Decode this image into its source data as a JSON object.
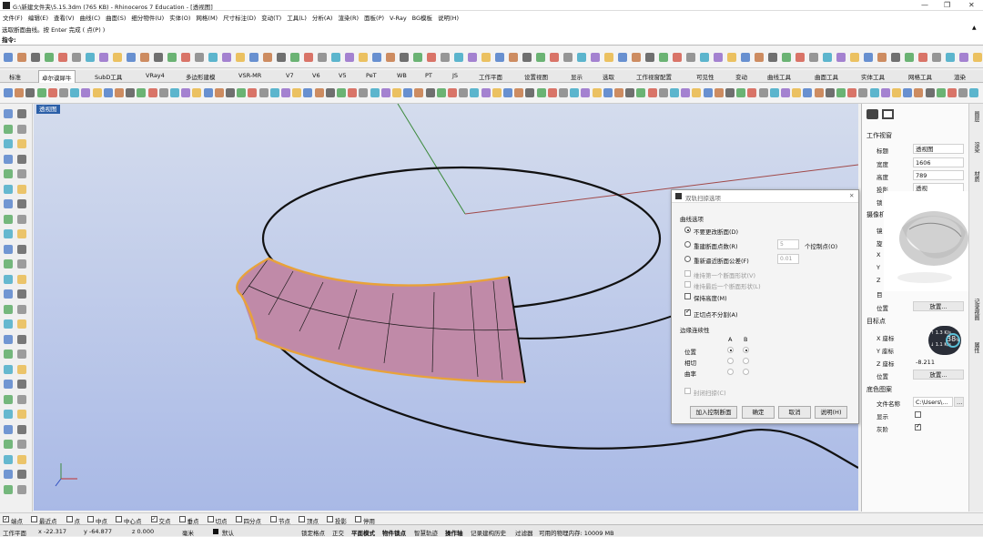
{
  "title": "G:\\新建文件夹\\5.15.3dm (765 KB) - Rhinoceros 7 Education - [透视图]",
  "menu": [
    "文件(F)",
    "编辑(E)",
    "查看(V)",
    "曲线(C)",
    "曲面(S)",
    "细分物件(U)",
    "实体(O)",
    "网格(M)",
    "尺寸标注(D)",
    "变动(T)",
    "工具(L)",
    "分析(A)",
    "渲染(R)",
    "面板(P)",
    "V-Ray",
    "BG模板",
    "说明(H)"
  ],
  "command": {
    "history": "选取断面曲线。按 Enter 完成 ( 点(P) )",
    "prompt": "指令:"
  },
  "tabs": [
    "标准",
    "卓尔谟犀牛",
    "SubD工具",
    "VRay4",
    "多边形建模",
    "VSR-MR",
    "V7",
    "V6",
    "V5",
    "PeT",
    "WB",
    "PT",
    "JS",
    "工作平面",
    "设置视图",
    "显示",
    "选取",
    "工作视窗配置",
    "可见性",
    "变动",
    "曲线工具",
    "曲面工具",
    "实体工具",
    "网格工具",
    "渲染"
  ],
  "viewport": {
    "label": "透视图"
  },
  "dialog": {
    "title": "双轨扫掠选项",
    "section_curve": "曲线选项",
    "opt1": "不要更改断面(D)",
    "opt2": "重建断面点数(R)",
    "opt2_val": "5",
    "opt2_unit": "个控制点(O)",
    "opt3": "重新逼近断面公差(F)",
    "opt3_val": "0.01",
    "keep_first": "维持第一个断面形状(V)",
    "keep_last": "维持最后一个断面形状(L)",
    "keep_height": "保持高度(M)",
    "no_split": "正切点不分割(A)",
    "section_cont": "边缘连续性",
    "col_a": "A",
    "col_b": "B",
    "row_pos": "位置",
    "row_tan": "相切",
    "row_curv": "曲率",
    "closed": "封闭扫掠(C)",
    "btn_add": "加入控制断面",
    "btn_ok": "确定",
    "btn_cancel": "取消",
    "btn_help": "说明(H)"
  },
  "panel": {
    "section_view": "工作视窗",
    "title_lbl": "标题",
    "title_val": "透视图",
    "width_lbl": "宽度",
    "width_val": "1606",
    "height_lbl": "高度",
    "height_val": "789",
    "proj_lbl": "投影",
    "proj_val": "透视",
    "lock_lbl": "锁",
    "section_cam": "摄像机",
    "lens_lbl": "镜",
    "rot_lbl": "旋",
    "x_lbl": "X",
    "y_lbl": "Y",
    "z_lbl": "Z",
    "target_lbl": "目",
    "pos_lbl": "位置",
    "place_btn": "放置...",
    "section_target": "目标点",
    "tx_lbl": "X 座标",
    "ty_lbl": "Y 座标",
    "tz_lbl": "Z 座标",
    "tz_val": "-8.211",
    "tpos_lbl": "位置",
    "tplace_btn": "放置...",
    "section_bg": "底色图案",
    "file_lbl": "文件名称",
    "file_val": "C:\\Users\\...",
    "show_lbl": "显示",
    "gray_lbl": "灰阶",
    "perf_val": "38",
    "perf_unit": "%",
    "perf_up": "1.3",
    "perf_down": "1.1",
    "perf_rate": "K/s"
  },
  "sidetabs": [
    "图层",
    "渲染",
    "材质",
    "记录视图",
    "属性"
  ],
  "osnap": [
    "端点",
    "最近点",
    "点",
    "中点",
    "中心点",
    "交点",
    "垂点",
    "切点",
    "四分点",
    "节点",
    "顶点",
    "投影",
    "停用"
  ],
  "osnap_checked": [
    true,
    false,
    false,
    false,
    false,
    true,
    false,
    false,
    false,
    false,
    false,
    false,
    false
  ],
  "status": {
    "cplane": "工作平面",
    "x": "x -22.317",
    "y": "y -64.877",
    "z": "z 0.000",
    "unit": "毫米",
    "layer": "默认",
    "items": [
      "锁定格点",
      "正交",
      "平面模式",
      "物件锁点",
      "智慧轨迹",
      "操作轴",
      "记录建构历史",
      "过滤器"
    ],
    "memory": "可用的物理内存: 10009 MB"
  },
  "colors": {
    "surface": "#c08aa8",
    "edge": "#e8a23a",
    "viewport_top": "#d4dced",
    "viewport_bottom": "#a9b9e6",
    "accent": "#2b5fa8"
  }
}
